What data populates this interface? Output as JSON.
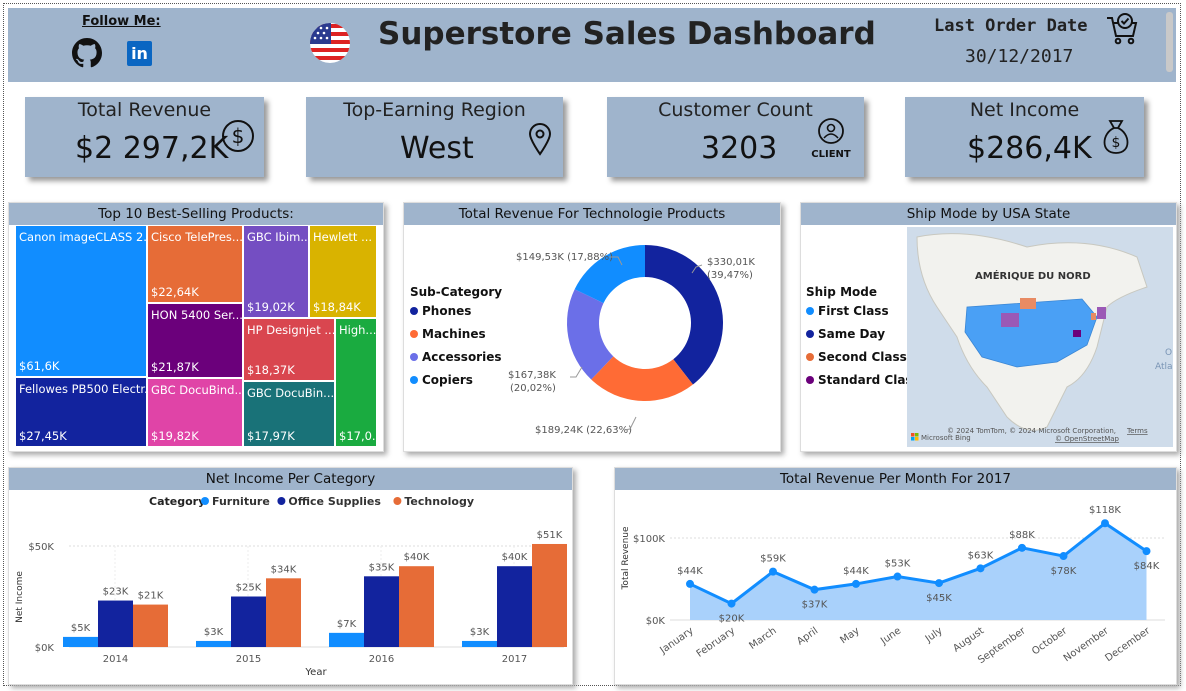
{
  "header": {
    "follow_label": "Follow Me:",
    "linkedin_text": "in",
    "title": "Superstore Sales Dashboard",
    "last_order_label": "Last Order Date",
    "last_order_value": "30/12/2017"
  },
  "kpis": {
    "revenue": {
      "label": "Total Revenue",
      "value": "$2 297,2K"
    },
    "region": {
      "label": "Top-Earning Region",
      "value": "West"
    },
    "customers": {
      "label": "Customer Count",
      "value": "3203",
      "icon_text": "CLIENT"
    },
    "net_income": {
      "label": "Net Income",
      "value": "$286,4K"
    }
  },
  "colors": {
    "header": "#9fb4cc",
    "furniture": "#118dff",
    "office": "#12239e",
    "technology": "#e66c37",
    "standard": "#6b007b"
  },
  "treemap": {
    "title": "Top 10 Best-Selling Products:",
    "items": [
      {
        "name": "Canon imageCLASS 2...",
        "value": "$61,6K",
        "color": "#118dff"
      },
      {
        "name": "Fellowes PB500 Electr...",
        "value": "$27,45K",
        "color": "#12239e"
      },
      {
        "name": "Cisco TelePres...",
        "value": "$22,64K",
        "color": "#e66c37"
      },
      {
        "name": "HON 5400 Ser...",
        "value": "$21,87K",
        "color": "#6b007b"
      },
      {
        "name": "GBC DocuBind...",
        "value": "$19,82K",
        "color": "#e044a7"
      },
      {
        "name": "GBC Ibim...",
        "value": "$19,02K",
        "color": "#744ec2"
      },
      {
        "name": "HP Designjet ...",
        "value": "$18,37K",
        "color": "#d9464f"
      },
      {
        "name": "GBC DocuBin...",
        "value": "$17,97K",
        "color": "#197278"
      },
      {
        "name": "Hewlett ...",
        "value": "$18,84K",
        "color": "#d9b300"
      },
      {
        "name": "High...",
        "value": "$17,0...",
        "color": "#1aab40"
      }
    ]
  },
  "donut": {
    "title": "Total Revenue For Technologie Products",
    "legend_title": "Sub-Category",
    "labels": {
      "phones": [
        "$330,01K",
        "(39,47%)"
      ],
      "machines": [
        "$189,24K (22,63%)"
      ],
      "accessories": [
        "$167,38K",
        "(20,02%)"
      ],
      "copiers": [
        "$149,53K (17,88%)"
      ]
    }
  },
  "map": {
    "title": "Ship Mode by USA State",
    "legend_title": "Ship Mode",
    "continent_label": "AMÉRIQUE DU NORD",
    "ocean_partial": [
      "O",
      "Atla"
    ],
    "attribution": "© 2024 TomTom, © 2024 Microsoft Corporation,",
    "terms": "Terms",
    "osm": "© OpenStreetMap",
    "bing": "Microsoft Bing"
  },
  "chart_data": [
    {
      "type": "bar",
      "title": "Top 10 Best-Selling Products:",
      "categories": [
        "Canon imageCLASS 2...",
        "Fellowes PB500 Electr...",
        "Cisco TelePres...",
        "HON 5400 Ser...",
        "GBC DocuBind...",
        "GBC Ibim...",
        "HP Designjet ...",
        "GBC DocuBin...",
        "Hewlett ...",
        "High..."
      ],
      "values": [
        61.6,
        27.45,
        22.64,
        21.87,
        19.82,
        19.02,
        18.37,
        17.97,
        18.84,
        17.0
      ]
    },
    {
      "type": "pie",
      "title": "Total Revenue For Technologie Products",
      "legend_title": "Sub-Category",
      "categories": [
        "Phones",
        "Machines",
        "Accessories",
        "Copiers"
      ],
      "values": [
        330.01,
        189.24,
        167.38,
        149.53
      ],
      "colors": [
        "#12239e",
        "#ff6b35",
        "#6b6fe8",
        "#118dff"
      ]
    },
    {
      "type": "bar",
      "title": "Net Income Per Category",
      "legend_title": "Category",
      "xlabel": "Year",
      "ylabel": "Net Income",
      "categories": [
        "2014",
        "2015",
        "2016",
        "2017"
      ],
      "series": [
        {
          "name": "Furniture",
          "values": [
            5,
            3,
            7,
            3
          ],
          "labels": [
            "$5K",
            "$3K",
            "$7K",
            "$3K"
          ]
        },
        {
          "name": "Office Supplies",
          "values": [
            23,
            25,
            35,
            40
          ],
          "labels": [
            "$23K",
            "$25K",
            "$35K",
            "$40K"
          ]
        },
        {
          "name": "Technology",
          "values": [
            21,
            34,
            40,
            51
          ],
          "labels": [
            "$21K",
            "$34K",
            "$40K",
            "$51K"
          ]
        }
      ],
      "yticks": [
        "$0K",
        "$50K"
      ],
      "ylim": [
        0,
        50
      ],
      "legend": "top"
    },
    {
      "type": "area",
      "title": "Total Revenue Per Month For 2017",
      "ylabel": "Total Revenue",
      "x": [
        "January",
        "February",
        "March",
        "April",
        "May",
        "June",
        "July",
        "August",
        "September",
        "October",
        "November",
        "December"
      ],
      "values": [
        44,
        20,
        59,
        37,
        44,
        53,
        45,
        63,
        88,
        78,
        118,
        84
      ],
      "labels": [
        "$44K",
        "$20K",
        "$59K",
        "$37K",
        "$44K",
        "$53K",
        "$45K",
        "$63K",
        "$88K",
        "$78K",
        "$118K",
        "$84K"
      ],
      "yticks": [
        "$0K",
        "$100K"
      ],
      "ylim": [
        0,
        100
      ]
    }
  ],
  "ship_modes": [
    {
      "name": "First Class",
      "color": "#118dff"
    },
    {
      "name": "Same Day",
      "color": "#12239e"
    },
    {
      "name": "Second Class",
      "color": "#e66c37"
    },
    {
      "name": "Standard Class",
      "color": "#6b007b"
    }
  ]
}
